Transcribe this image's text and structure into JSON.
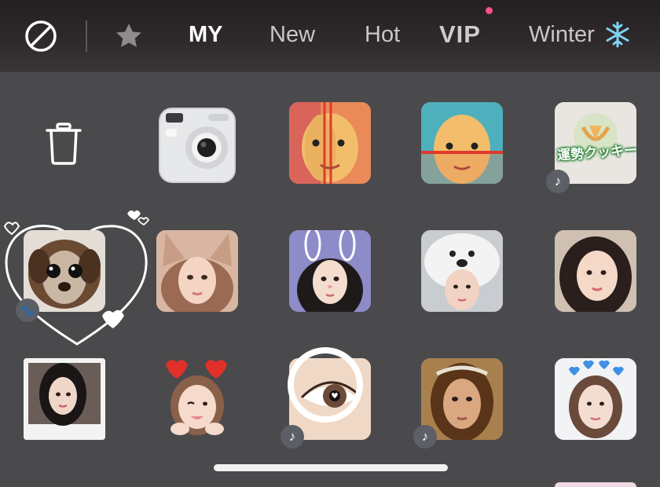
{
  "tabs": {
    "my": "MY",
    "new": "New",
    "hot": "Hot",
    "vip": "VIP",
    "winter": "Winter"
  },
  "icons": {
    "no_filter": "no-filter-icon",
    "favorites": "star-icon",
    "delete": "trash-icon",
    "music": "music-note-icon",
    "pet": "paw-icon",
    "snowflake": "snowflake-icon"
  },
  "grid": {
    "row1": [
      "trash",
      "instant-camera",
      "split-face-vertical",
      "split-face-horizontal",
      "fortune-cookie"
    ],
    "row2": [
      "pet-heart-frame",
      "cat-ears",
      "bunny-ears",
      "white-dog-hat",
      "natural-beauty"
    ],
    "row3": [
      "polaroid",
      "red-hearts-headband",
      "ring-eye",
      "renaissance-portrait",
      "blue-hearts-crown"
    ]
  },
  "fortune_cookie_label": "運勢クッキー",
  "colors": {
    "background": "#4a4a4d",
    "topbar": "#2a2527",
    "notification_dot": "#ff4f8b",
    "snowflake": "#7fd3f5"
  }
}
